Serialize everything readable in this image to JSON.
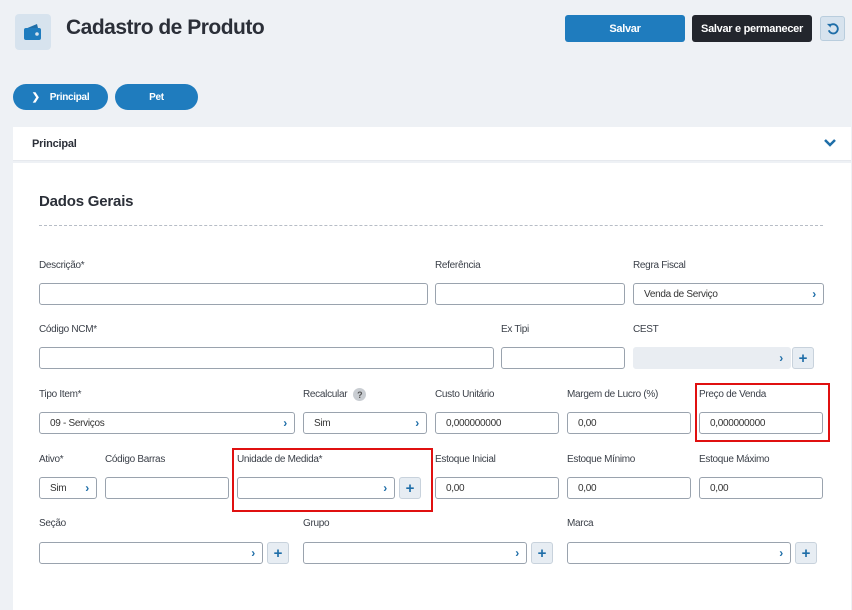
{
  "header": {
    "title": "Cadastro de Produto",
    "icon": "wallet-icon",
    "save_label": "Salvar",
    "save_stay_label": "Salvar e permanecer",
    "back_icon": "undo-icon"
  },
  "tabs": [
    {
      "label": "Principal",
      "active": true
    },
    {
      "label": "Pet",
      "active": false
    }
  ],
  "section": {
    "label": "Principal"
  },
  "form": {
    "title": "Dados Gerais",
    "descricao": {
      "label": "Descrição*",
      "value": ""
    },
    "referencia": {
      "label": "Referência",
      "value": ""
    },
    "regra_fiscal": {
      "label": "Regra Fiscal",
      "value": "Venda de Serviço"
    },
    "codigo_ncm": {
      "label": "Código NCM*",
      "value": ""
    },
    "ex_tipi": {
      "label": "Ex Tipi",
      "value": ""
    },
    "cest": {
      "label": "CEST",
      "value": ""
    },
    "tipo_item": {
      "label": "Tipo Item*",
      "value": "09 - Serviços"
    },
    "recalcular": {
      "label": "Recalcular",
      "value": "Sim",
      "help": "?"
    },
    "custo_unitario": {
      "label": "Custo Unitário",
      "value": "0,000000000"
    },
    "margem_lucro": {
      "label": "Margem de Lucro (%)",
      "value": "0,00"
    },
    "preco_venda": {
      "label": "Preço de Venda",
      "value": "0,000000000"
    },
    "ativo": {
      "label": "Ativo*",
      "value": "Sim"
    },
    "codigo_barras": {
      "label": "Código Barras",
      "value": ""
    },
    "unidade_medida": {
      "label": "Unidade de Medida*",
      "value": ""
    },
    "estoque_inicial": {
      "label": "Estoque Inicial",
      "value": "0,00"
    },
    "estoque_minimo": {
      "label": "Estoque Mínimo",
      "value": "0,00"
    },
    "estoque_maximo": {
      "label": "Estoque Máximo",
      "value": "0,00"
    },
    "secao": {
      "label": "Seção",
      "value": ""
    },
    "grupo": {
      "label": "Grupo",
      "value": ""
    },
    "marca": {
      "label": "Marca",
      "value": ""
    }
  },
  "colors": {
    "primary": "#1f7cbe",
    "dark": "#23262d",
    "highlight": "#e01010"
  }
}
